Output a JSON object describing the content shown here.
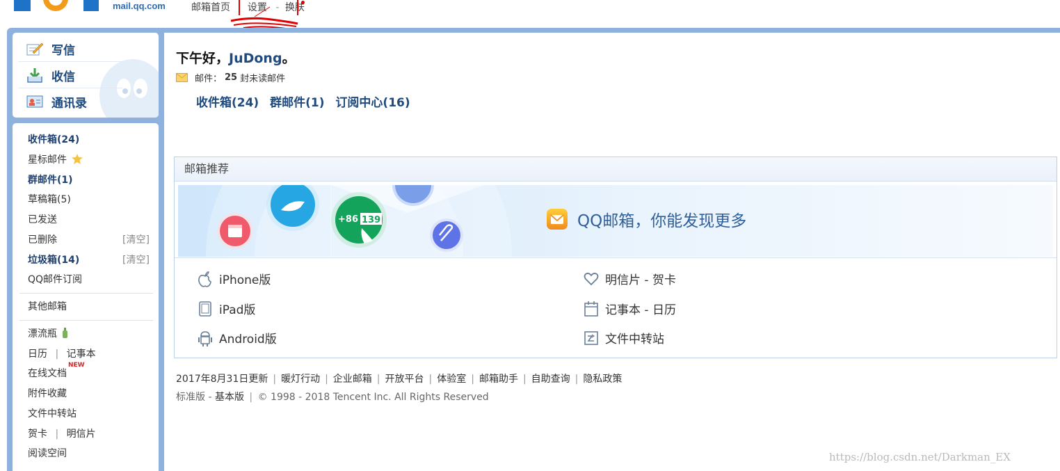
{
  "topbar": {
    "domain": "mail.qq.com",
    "nav": [
      "邮箱首页",
      "设置",
      "换肤"
    ],
    "nav_sep": "-"
  },
  "compose": {
    "write": "写信",
    "receive": "收信",
    "contacts": "通讯录"
  },
  "folders": {
    "inbox": "收件箱(24)",
    "starred": "星标邮件",
    "group": "群邮件(1)",
    "drafts": "草稿箱(5)",
    "sent": "已发送",
    "deleted": "已删除",
    "spam": "垃圾箱(14)",
    "clear": "[清空]",
    "subscribe": "QQ邮件订阅",
    "other": "其他邮箱",
    "drift": "漂流瓶",
    "calendar": "日历",
    "notes": "记事本",
    "docs": "在线文档",
    "new_badge": "NEW",
    "attach": "附件收藏",
    "transfer": "文件中转站",
    "card": "贺卡",
    "postcard": "明信片",
    "reading": "阅读空间",
    "pipe": "|"
  },
  "main": {
    "greeting": "下午好，",
    "username": "JuDong",
    "greeting_end": "。",
    "mail_label": "邮件：",
    "unread_count": "25",
    "unread_unit": "封",
    "unread_link": "未读邮件",
    "quick": [
      "收件箱(24)",
      "群邮件(1)",
      "订阅中心(16)"
    ]
  },
  "recommend": {
    "title": "邮箱推荐",
    "banner_text": "QQ邮箱，你能发现更多",
    "banner_phone": "+86",
    "banner_number": "139",
    "items": {
      "iphone": "iPhone版",
      "ipad": "iPad版",
      "android": "Android版",
      "postcard": "明信片 - 贺卡",
      "notes": "记事本 - 日历",
      "transfer": "文件中转站"
    }
  },
  "footer": {
    "links": [
      "2017年8月31日更新",
      "暖灯行动",
      "企业邮箱",
      "开放平台",
      "体验室",
      "邮箱助手",
      "自助查询",
      "隐私政策"
    ],
    "bar": "|",
    "version_std": "标准版",
    "version_dash": "-",
    "version_basic": "基本版",
    "copyright": "© 1998 - 2018 Tencent Inc. All Rights Reserved"
  },
  "watermark": "https://blog.csdn.net/Darkman_EX",
  "colors": {
    "frame": "#8eb1de",
    "link_blue": "#1f4a7e",
    "accent_red": "#d00000"
  }
}
